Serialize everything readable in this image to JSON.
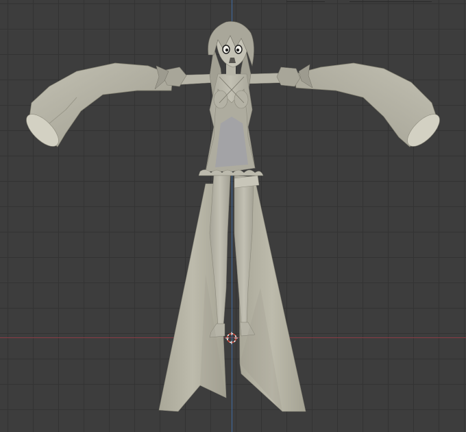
{
  "viewport": {
    "label": "3D viewport",
    "background": "#3d3d3d",
    "grid_color": "#333333",
    "x_axis_color": "#8a3c45",
    "y_axis_color": "#3f6aa0",
    "model_color": "#b5b3a4"
  },
  "icons": {
    "cursor": "3d-cursor-icon"
  }
}
